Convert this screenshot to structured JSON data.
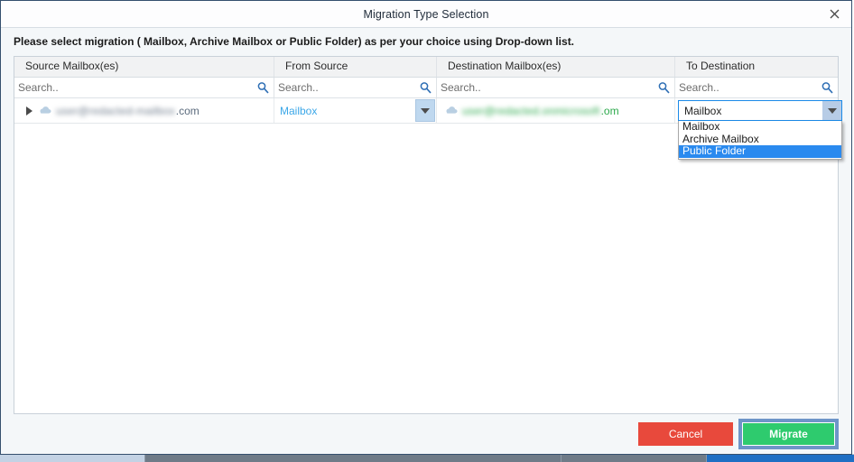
{
  "window": {
    "title": "Migration Type Selection",
    "close_icon": "close-icon",
    "instruction": "Please select migration ( Mailbox, Archive Mailbox or Public Folder) as per your choice using Drop-down list."
  },
  "grid": {
    "columns": [
      {
        "header": "Source Mailbox(es)",
        "search_placeholder": "Search..",
        "search_value": "",
        "search_icon": "search-icon"
      },
      {
        "header": "From Source",
        "search_placeholder": "Search..",
        "search_value": "",
        "search_icon": "search-icon"
      },
      {
        "header": "Destination Mailbox(es)",
        "search_placeholder": "Search..",
        "search_value": "",
        "search_icon": "search-icon"
      },
      {
        "header": "To Destination",
        "search_placeholder": "Search..",
        "search_value": "",
        "search_icon": "search-icon"
      }
    ],
    "rows": [
      {
        "expander_icon": "expand-triangle-icon",
        "source_cloud_icon": "cloud-icon",
        "source_mailbox_redacted": "user@redacted-mailbox",
        "source_mailbox_visible_tail": ".com",
        "from_source_value": "Mailbox",
        "from_source_arrow_icon": "chevron-down-icon",
        "destination_cloud_icon": "cloud-icon",
        "destination_mailbox_redacted": "user@redacted.onmicrosoft",
        "destination_mailbox_visible_tail": ".om",
        "to_destination_value": "Mailbox",
        "to_destination_arrow_icon": "chevron-down-icon"
      }
    ]
  },
  "dropdown": {
    "open": true,
    "selected": "Public Folder",
    "options": [
      "Mailbox",
      "Archive Mailbox",
      "Public Folder"
    ]
  },
  "footer": {
    "cancel_label": "Cancel",
    "migrate_label": "Migrate"
  },
  "colors": {
    "cancel_red": "#e8493c",
    "migrate_green": "#2ecb6e",
    "focus_blue": "#6e95c8",
    "highlight_blue": "#2a8aef",
    "link_blue": "#3ba7e8",
    "combo_border_blue": "#1b8ae8"
  }
}
